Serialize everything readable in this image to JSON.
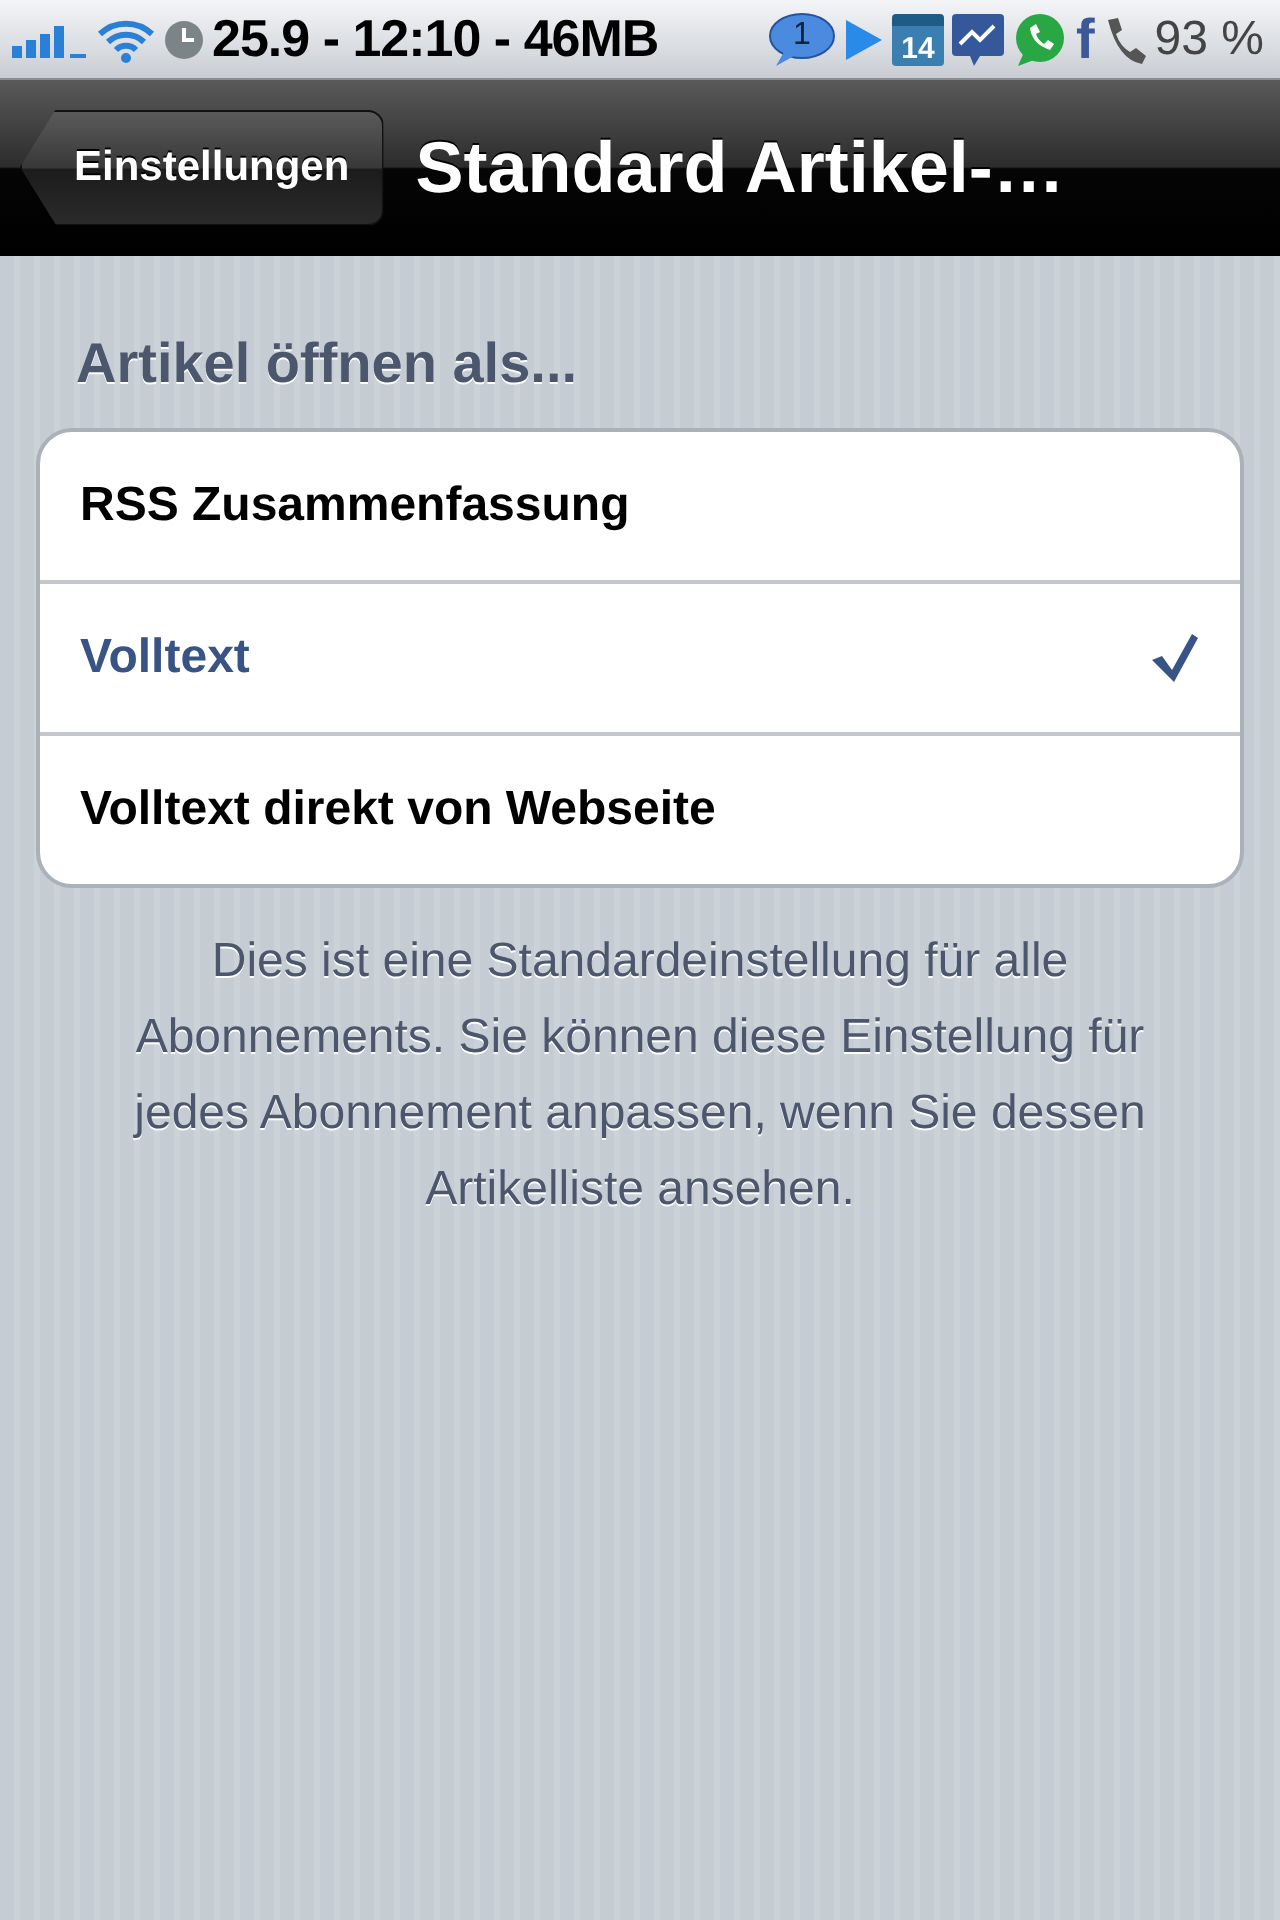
{
  "status_bar": {
    "info": "25.9 - 12:10 - 46MB",
    "notification_count": "1",
    "calendar_day": "14",
    "facebook_glyph": "f",
    "battery": "93 %"
  },
  "nav_bar": {
    "back": "Einstellungen",
    "title": "Standard Artikel-…"
  },
  "section": {
    "header": "Artikel öffnen als...",
    "options": [
      {
        "label": "RSS Zusammenfassung",
        "selected": false
      },
      {
        "label": "Volltext",
        "selected": true
      },
      {
        "label": "Volltext direkt von Webseite",
        "selected": false
      }
    ],
    "footer": "Dies ist eine Standardeinstellung für alle Abonnements. Sie können diese Einstellung für jedes Abonnement anpassen, wenn Sie dessen Artikelliste ansehen."
  }
}
